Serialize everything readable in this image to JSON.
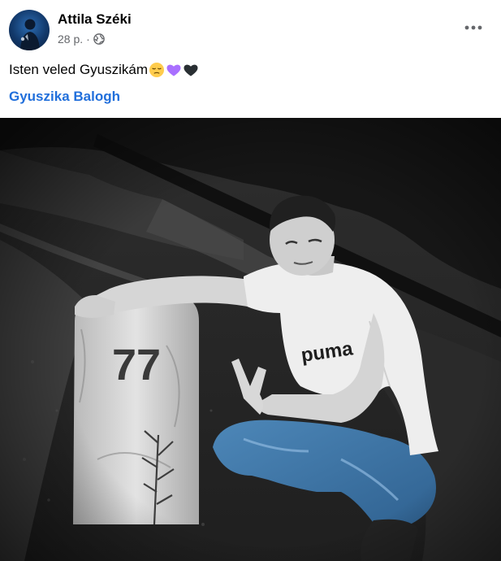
{
  "post": {
    "author": "Attila Széki",
    "time": "28 p.",
    "separator": "·",
    "text": "Isten veled Gyuszikám",
    "emojis": [
      "pensive-face",
      "purple-heart",
      "black-heart"
    ],
    "tagged_person": "Gyuszika Balogh"
  },
  "photo": {
    "milestone_number": "77",
    "shirt_text": "puma"
  },
  "colors": {
    "link": "#216fdb",
    "meta": "#65676b",
    "text": "#050505"
  }
}
